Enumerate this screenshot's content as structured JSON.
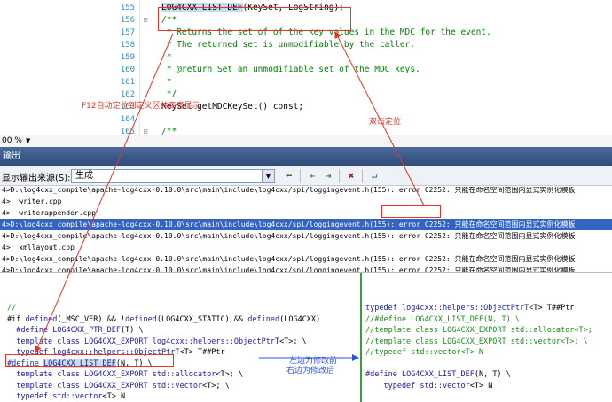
{
  "editor": {
    "lines": [
      {
        "num": "155",
        "fold": "",
        "segments": [
          [
            "black",
            "LOG4CXX_LIST_DEF",
            "hl"
          ],
          [
            "black",
            "(KeySet, LogString);",
            ""
          ]
        ]
      },
      {
        "num": "156",
        "fold": "⊟",
        "segments": [
          [
            "green",
            "/**",
            ""
          ]
        ]
      },
      {
        "num": "157",
        "fold": "",
        "segments": [
          [
            "green",
            " * Returns the set of of the key values in the MDC for the event.",
            ""
          ]
        ]
      },
      {
        "num": "158",
        "fold": "",
        "segments": [
          [
            "green",
            " * The returned set is unmodifiable by the caller.",
            ""
          ]
        ]
      },
      {
        "num": "159",
        "fold": "",
        "segments": [
          [
            "green",
            " *",
            ""
          ]
        ]
      },
      {
        "num": "160",
        "fold": "",
        "segments": [
          [
            "green",
            " * @return Set an unmodifiable set of the MDC keys.",
            ""
          ]
        ]
      },
      {
        "num": "161",
        "fold": "",
        "segments": [
          [
            "green",
            " *",
            ""
          ]
        ]
      },
      {
        "num": "162",
        "fold": "",
        "segments": [
          [
            "green",
            " */",
            ""
          ]
        ]
      },
      {
        "num": "163",
        "fold": "",
        "segments": [
          [
            "black",
            "KeySet getMDCKeySet() const;",
            ""
          ]
        ]
      },
      {
        "num": "164",
        "fold": "",
        "segments": [
          [
            "black",
            "",
            ""
          ]
        ]
      },
      {
        "num": "165",
        "fold": "⊟",
        "segments": [
          [
            "green",
            "/**",
            ""
          ]
        ]
      }
    ],
    "zoom": "00 %"
  },
  "output": {
    "title": "输出",
    "source_label": "显示输出来源(S):",
    "source_value": "生成",
    "lines": [
      {
        "text": "4>D:\\log4cxx_compile\\apache-log4cxx-0.10.0\\src\\main\\include\\log4cxx/spi/loggingevent.h(155): error C2252: 只能在命名空间范围内显式实例化模板",
        "sel": false
      },
      {
        "text": "4>  writer.cpp",
        "sel": false
      },
      {
        "text": "4>  writerappender.cpp",
        "sel": false
      },
      {
        "text": "4>D:\\log4cxx_compile\\apache-log4cxx-0.10.0\\src\\main\\include\\log4cxx/spi/loggingevent.h(155): error C2252: 只能在命名空间范围内显式实例化模板",
        "sel": true
      },
      {
        "text": "4>D:\\log4cxx_compile\\apache-log4cxx-0.10.0\\src\\main\\include\\log4cxx/spi/loggingevent.h(155): error C2252: 只能在命名空间范围内显式实例化模板",
        "sel": false
      },
      {
        "text": "4>  xmllayout.cpp",
        "sel": false
      },
      {
        "text": "4>D:\\log4cxx_compile\\apache-log4cxx-0.10.0\\src\\main\\include\\log4cxx/spi/loggingevent.h(155): error C2252: 只能在命名空间范围内显式实例化模板",
        "sel": false
      },
      {
        "text": "4>D:\\log4cxx_compile\\apache-log4cxx-0.10.0\\src\\main\\include\\log4cxx/spi/loggingevent.h(155): error C2252: 只能在命名空间范围内显式实例化模板",
        "sel": false
      }
    ]
  },
  "diff": {
    "left": [
      [
        [
          "g",
          "//"
        ]
      ],
      [
        [
          "b",
          "#if "
        ],
        [
          "k",
          "defined"
        ],
        [
          "b",
          "(_MSC_VER) && !"
        ],
        [
          "k",
          "defined"
        ],
        [
          "b",
          "(LOG4CXX_STATIC) && "
        ],
        [
          "k",
          "defined"
        ],
        [
          "b",
          "(LOG4CXX)"
        ]
      ],
      [
        [
          "k",
          "  #define "
        ],
        [
          "k",
          "LOG4CXX_PTR_DEF"
        ],
        [
          "b",
          "(T) \\"
        ]
      ],
      [
        [
          "k",
          "  template class "
        ],
        [
          "k",
          "LOG4CXX_EXPORT "
        ],
        [
          "k",
          "log4cxx::helpers::ObjectPtrT"
        ],
        [
          "b",
          "<T>; \\"
        ]
      ],
      [
        [
          "k",
          "  typedef "
        ],
        [
          "k",
          "log4cxx::helpers::ObjectPtrT"
        ],
        [
          "b",
          "<T> T##Ptr"
        ]
      ],
      [
        [
          "k",
          "#define "
        ],
        [
          "hlb",
          "LOG4CXX_LIST_DEF"
        ],
        [
          "b",
          "(N, T) \\"
        ]
      ],
      [
        [
          "k",
          "  template class "
        ],
        [
          "k",
          "LOG4CXX_EXPORT "
        ],
        [
          "k",
          "std::allocator"
        ],
        [
          "b",
          "<T>; \\"
        ]
      ],
      [
        [
          "k",
          "  template class "
        ],
        [
          "k",
          "LOG4CXX_EXPORT "
        ],
        [
          "k",
          "std::vector"
        ],
        [
          "b",
          "<T>; \\"
        ]
      ],
      [
        [
          "k",
          "  typedef "
        ],
        [
          "k",
          "std::vector"
        ],
        [
          "b",
          "<T> N"
        ]
      ]
    ],
    "right": [
      [
        [
          "k",
          "typedef "
        ],
        [
          "k",
          "log4cxx::helpers::ObjectPtrT"
        ],
        [
          "b",
          "<T> T##Ptr"
        ]
      ],
      [
        [
          "g",
          "//#define LOG4CXX_LIST_DEF(N, T) \\"
        ]
      ],
      [
        [
          "g",
          "//template class LOG4CXX_EXPORT std::allocator<T>;"
        ]
      ],
      [
        [
          "g",
          "//template class LOG4CXX_EXPORT std::vector<T>; \\"
        ]
      ],
      [
        [
          "g",
          "//typedef std::vector<T> N"
        ]
      ],
      [
        [
          "b",
          ""
        ]
      ],
      [
        [
          "k",
          "#define "
        ],
        [
          "k",
          "LOG4CXX_LIST_DEF"
        ],
        [
          "b",
          "(N, T) \\"
        ]
      ],
      [
        [
          "k",
          "    typedef "
        ],
        [
          "k",
          "std::vector"
        ],
        [
          "b",
          "<T> N"
        ]
      ]
    ]
  },
  "annotations": {
    "f12_note": "F12自动定位到定义区并高亮显示",
    "dblclick_note": "双击定位",
    "left_note": "左边为修改前",
    "right_note": "右边为修改后"
  },
  "colors": {
    "annotation_red": "#e8332b",
    "annotation_blue": "#2a4ef0",
    "selected_row": "#3363c3",
    "comment_green": "#008000"
  }
}
